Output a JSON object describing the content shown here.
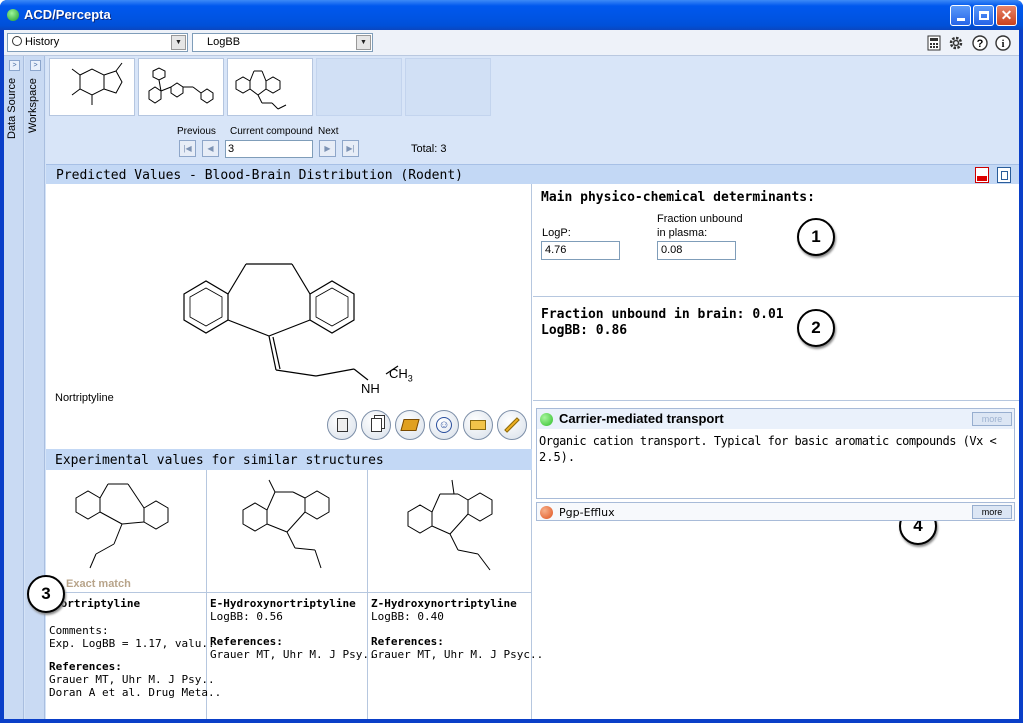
{
  "window": {
    "title": "ACD/Percepta"
  },
  "toolbar": {
    "history": {
      "value": "History"
    },
    "property": {
      "value": "LogBB"
    }
  },
  "sidebar": {
    "data_source": "Data Source",
    "workspace": "Workspace"
  },
  "navigation": {
    "previous_label": "Previous",
    "current_label": "Current compound",
    "next_label": "Next",
    "current_value": "3",
    "total": "Total: 3"
  },
  "predicted": {
    "title": "Predicted Values - Blood-Brain Distribution (Rodent)",
    "structure_name": "Nortriptyline",
    "amine_label_nh": "NH",
    "amine_label_ch3": "CH",
    "amine_label_sub": "3"
  },
  "experimental": {
    "title": "Experimental values for similar structures",
    "exact_match": "Exact match",
    "items": [
      {
        "name": "Nortriptyline",
        "comments_label": "Comments:",
        "comments": "Exp. LogBB = 1.17, valu..",
        "refs_label": "References:",
        "refs": [
          "Grauer MT, Uhr M. J Psy..",
          "Doran A et al. Drug Meta.."
        ]
      },
      {
        "name": "E-Hydroxynortriptyline",
        "logbb": "LogBB: 0.56",
        "refs_label": "References:",
        "refs": [
          "Grauer MT, Uhr M. J Psy.."
        ]
      },
      {
        "name": "Z-Hydroxynortriptyline",
        "logbb": "LogBB: 0.40",
        "refs_label": "References:",
        "refs": [
          "Grauer MT, Uhr M. J Psyc.."
        ]
      }
    ]
  },
  "determinants": {
    "title": "Main physico-chemical determinants:",
    "logp_label": "LogP:",
    "logp_value": "4.76",
    "fu_label_1": "Fraction unbound",
    "fu_label_2": "in plasma:",
    "fu_value": "0.08"
  },
  "results": {
    "fu_brain": "Fraction unbound in brain: 0.01",
    "logbb": "LogBB: 0.86"
  },
  "transport": {
    "carrier_title": "Carrier-mediated transport",
    "carrier_text_1": "Organic cation transport. Typical for basic aromatic compounds (Vx <",
    "carrier_text_2": "2.5).",
    "carrier_more": "more",
    "pgp_title": "Pgp-Efflux",
    "pgp_more": "more"
  },
  "callouts": [
    "1",
    "2",
    "3",
    "4"
  ],
  "colors": {
    "titlebar": "#0054e3",
    "green_dot": "#2fbf2a",
    "red_dot": "#e0531e"
  }
}
